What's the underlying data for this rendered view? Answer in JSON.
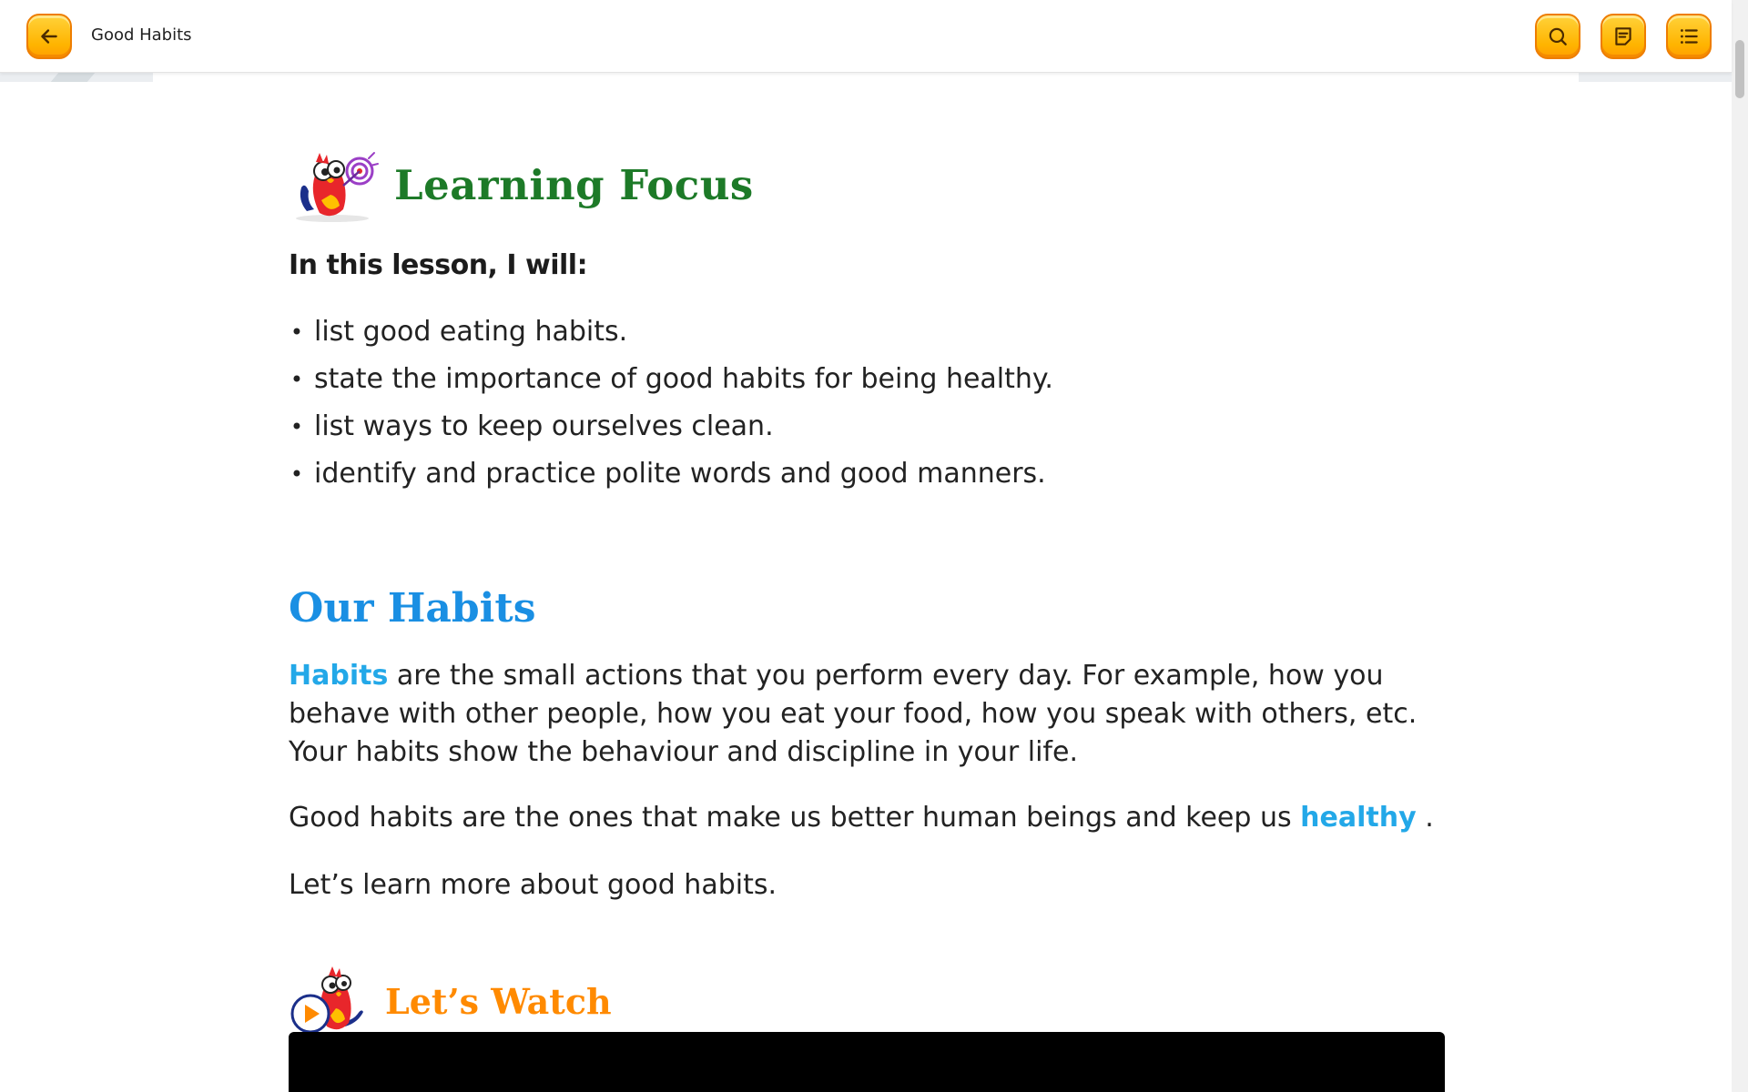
{
  "header": {
    "title": "Good Habits",
    "back_icon": "arrow-left-icon",
    "search_icon": "search-icon",
    "notes_icon": "notes-icon",
    "menu_icon": "list-menu-icon",
    "accent_color": "#ffb400"
  },
  "learning_focus": {
    "title": "Learning Focus",
    "intro": "In this lesson, I will:",
    "items": [
      "list good eating habits.",
      "state the importance of good habits for being healthy.",
      "list ways to keep ourselves clean.",
      "identify and practice polite words and good manners."
    ],
    "bullet": "•",
    "color": "#1d7a28"
  },
  "our_habits": {
    "title": "Our Habits",
    "para1_keyword": "Habits",
    "para1_rest": " are the small actions that you perform every day. For example, how you behave with other people, how you eat your food, how you speak with others, etc. Your habits show the behaviour and discipline in your life.",
    "para2_start": "Good habits are the ones that make us better human beings and keep us ",
    "para2_keyword": "healthy",
    "para2_end": " .",
    "para3": "Let’s learn more about good habits.",
    "color": "#1a8fe3",
    "keyword_color": "#23a8e8"
  },
  "lets_watch": {
    "title": "Let’s Watch",
    "play_icon": "play-icon",
    "color": "#ff8a00"
  }
}
